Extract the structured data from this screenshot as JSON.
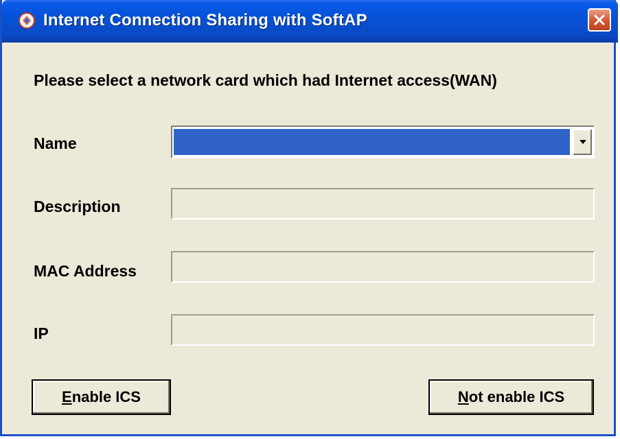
{
  "window": {
    "title": "Internet  Connection Sharing with SoftAP"
  },
  "prompt": "Please select a network card which had Internet access(WAN)",
  "fields": {
    "name_label": "Name",
    "name_value": "",
    "description_label": "Description",
    "description_value": "",
    "mac_label": "MAC Address",
    "mac_value": "",
    "ip_label": "IP",
    "ip_value": ""
  },
  "buttons": {
    "enable": {
      "mnemonic": "E",
      "rest": "nable ICS"
    },
    "not_enable": {
      "mnemonic": "N",
      "rest": "ot enable ICS"
    }
  },
  "colors": {
    "titlebar": "#0a5ae8",
    "selection": "#2f63c7",
    "face": "#ece9d8",
    "close": "#d25532"
  },
  "icons": [
    "app-icon",
    "close-icon",
    "dropdown-arrow-icon"
  ]
}
